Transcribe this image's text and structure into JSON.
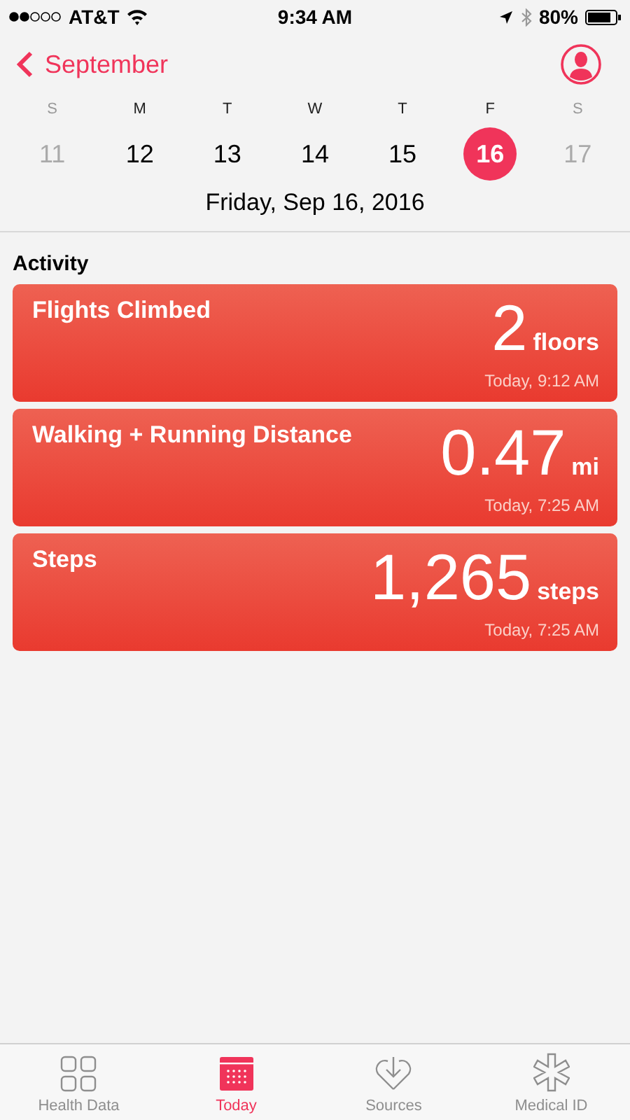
{
  "status_bar": {
    "carrier": "AT&T",
    "time": "9:34 AM",
    "battery": "80%"
  },
  "nav": {
    "back": "September"
  },
  "week": [
    {
      "letter": "S",
      "day": "11",
      "selected": false,
      "muted": true
    },
    {
      "letter": "M",
      "day": "12",
      "selected": false,
      "muted": false
    },
    {
      "letter": "T",
      "day": "13",
      "selected": false,
      "muted": false
    },
    {
      "letter": "W",
      "day": "14",
      "selected": false,
      "muted": false
    },
    {
      "letter": "T",
      "day": "15",
      "selected": false,
      "muted": false
    },
    {
      "letter": "F",
      "day": "16",
      "selected": true,
      "muted": false
    },
    {
      "letter": "S",
      "day": "17",
      "selected": false,
      "muted": true
    }
  ],
  "date": "Friday, Sep 16, 2016",
  "section": "Activity",
  "cards": [
    {
      "title": "Flights Climbed",
      "value": "2",
      "unit": "floors",
      "time": "Today, 9:12 AM"
    },
    {
      "title": "Walking + Running Distance",
      "value": "0.47",
      "unit": "mi",
      "time": "Today, 7:25 AM"
    },
    {
      "title": "Steps",
      "value": "1,265",
      "unit": "steps",
      "time": "Today, 7:25 AM"
    }
  ],
  "tabs": [
    {
      "kind": "grid",
      "label": "Health Data",
      "selected": false
    },
    {
      "kind": "calendar",
      "label": "Today",
      "selected": true
    },
    {
      "kind": "heart",
      "label": "Sources",
      "selected": false
    },
    {
      "kind": "asterisk",
      "label": "Medical ID",
      "selected": false
    }
  ]
}
